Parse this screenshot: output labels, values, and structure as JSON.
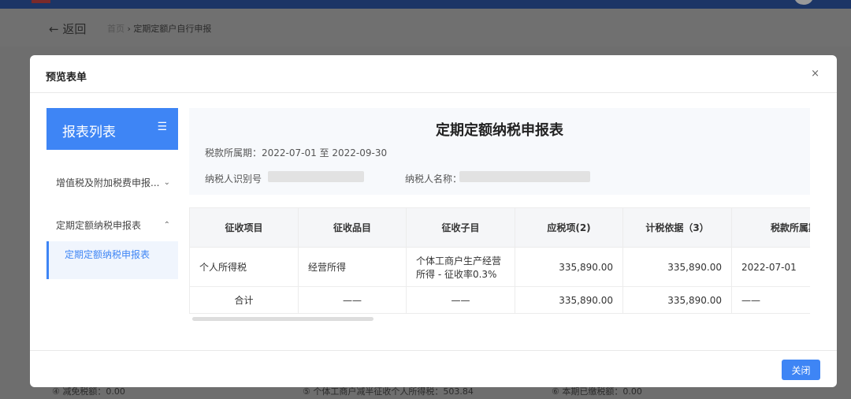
{
  "header": {
    "back": "← 返回",
    "crumb_home": "首页",
    "crumb_sep": "›",
    "crumb_current": "定期定额户自行申报"
  },
  "background_fields": [
    "④ 减免税额：0.00",
    "⑤ 个体工商户减半征收个人所得税：503.84",
    "⑥ 本期已缴税额：0.00"
  ],
  "modal": {
    "title": "预览表单",
    "close_icon": "×",
    "close_button": "关闭"
  },
  "sidebar": {
    "title": "报表列表",
    "menu_icon": "☰",
    "groups": [
      {
        "label": "增值税及附加税费申报...",
        "chevron": "⌄"
      },
      {
        "label": "定期定额纳税申报表",
        "chevron": "⌃",
        "items": [
          "定期定额纳税申报表"
        ]
      }
    ]
  },
  "report": {
    "title": "定期定额纳税申报表",
    "period": "税款所属期：2022-07-01 至 2022-09-30",
    "taxpayer_id_label": "纳税人识别号",
    "taxpayer_name_label": "纳税人名称：",
    "columns": [
      "征收项目",
      "征收品目",
      "征收子目",
      "应税项(2)",
      "计税依据（3）",
      "税款所属期起"
    ],
    "rows": [
      [
        "个人所得税",
        "经营所得",
        "个体工商户生产经营所得 - 征收率0.3%",
        "335,890.00",
        "335,890.00",
        "2022-07-01"
      ]
    ],
    "total": [
      "合计",
      "——",
      "——",
      "335,890.00",
      "335,890.00",
      "——"
    ]
  },
  "colors": {
    "accent": "#3e85f5",
    "topbar": "#1c3566"
  }
}
